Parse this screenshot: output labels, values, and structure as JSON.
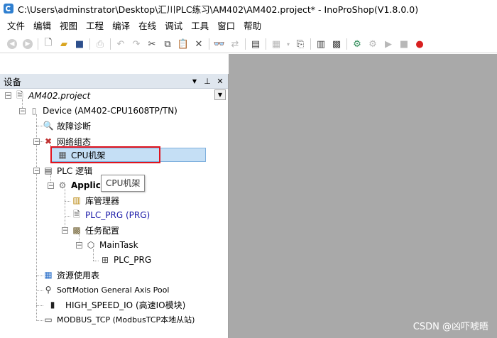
{
  "window": {
    "title": "C:\\Users\\adminstrator\\Desktop\\汇川PLC练习\\AM402\\AM402.project* - InoProShop(V1.8.0.0)"
  },
  "menu": [
    "文件",
    "编辑",
    "视图",
    "工程",
    "编译",
    "在线",
    "调试",
    "工具",
    "窗口",
    "帮助"
  ],
  "panel": {
    "title": "设备",
    "buttons": {
      "dropdown": "▼",
      "pin": "ᵖ",
      "close": "✕"
    }
  },
  "tree": {
    "project": "AM402.project",
    "device": "Device (AM402-CPU1608TP/TN)",
    "diagnostics": "故障诊断",
    "network": "网络组态",
    "cpu_rack": "CPU机架",
    "plc_logic": "PLC 逻辑",
    "application": "Applica",
    "library_manager": "库管理器",
    "plc_prg": "PLC_PRG (PRG)",
    "task_config": "任务配置",
    "main_task": "MainTask",
    "plc_prg_call": "PLC_PRG",
    "resource_usage": "资源使用表",
    "softmotion": "SoftMotion General Axis Pool",
    "high_speed_io": "HIGH_SPEED_IO (高速IO模块)",
    "modbus_tcp": "MODBUS_TCP (ModbusTCP本地从站)"
  },
  "tooltip": "CPU机架",
  "watermark": "CSDN @凶吓唬晤",
  "colors": {
    "selection": "#c5dff5",
    "highlight_box": "#e0141e",
    "workspace": "#a9a9a9",
    "link_blue": "#1a1aa8"
  }
}
